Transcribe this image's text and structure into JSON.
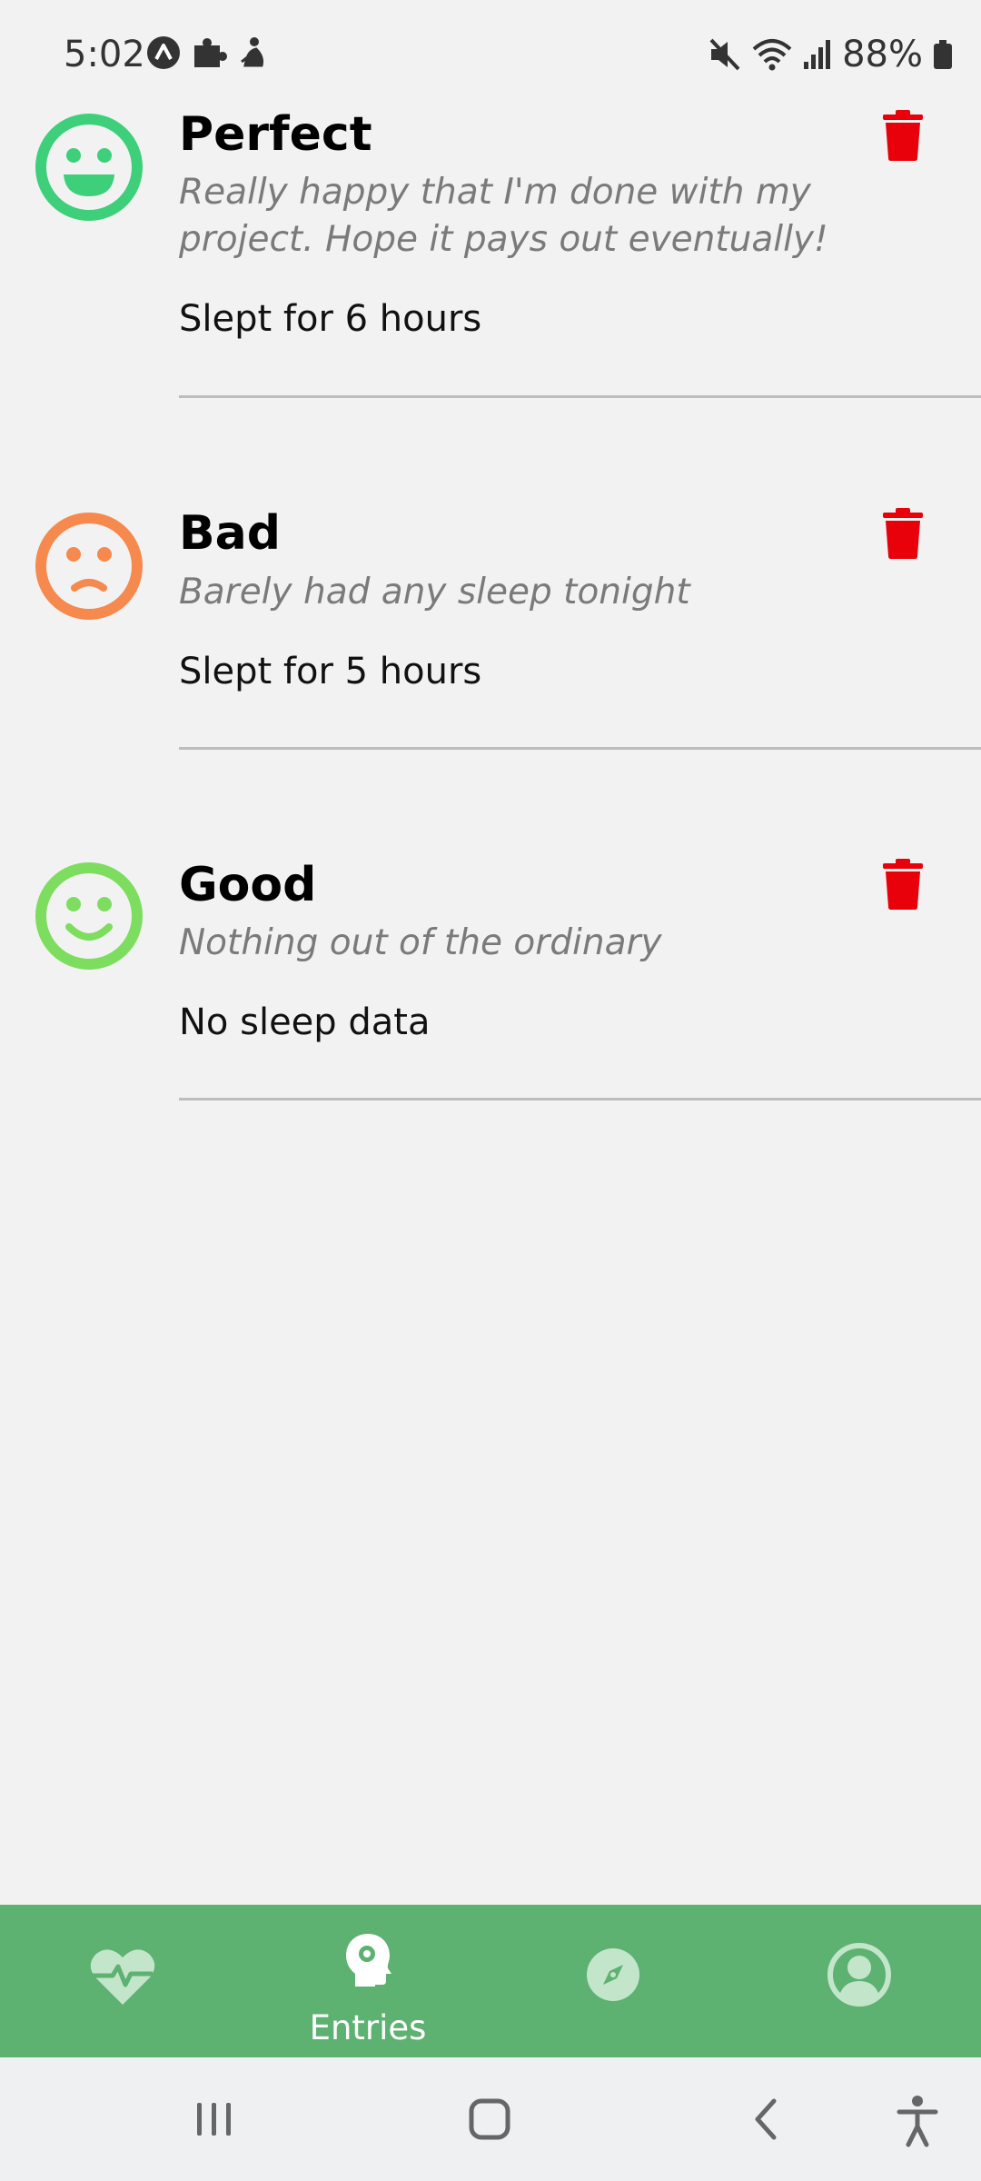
{
  "status_bar": {
    "time": "5:02",
    "battery": "88%",
    "left_icons": [
      "app-a-icon",
      "puzzle-icon",
      "figure-icon"
    ],
    "right_icons": [
      "mute-icon",
      "wifi-icon",
      "signal-icon",
      "battery-icon"
    ]
  },
  "entries": [
    {
      "mood": "Perfect",
      "note": "Really happy that I'm done with my project. Hope it pays out eventually!",
      "sleep": "Slept for 6 hours",
      "face": "grin",
      "color": "#3ecf7a"
    },
    {
      "mood": "Bad",
      "note": "Barely had any sleep tonight",
      "sleep": "Slept for 5 hours",
      "face": "sad",
      "color": "#f5894e"
    },
    {
      "mood": "Good",
      "note": "Nothing out of the ordinary",
      "sleep": "No sleep data",
      "face": "smile",
      "color": "#7ddd5e"
    }
  ],
  "colors": {
    "delete": "#e8000b",
    "nav_background": "#5db171",
    "background": "#f2f2f2"
  },
  "bottom_nav": {
    "items": [
      {
        "icon": "heart-pulse-icon",
        "label": "",
        "active": false
      },
      {
        "icon": "head-gear-icon",
        "label": "Entries",
        "active": true
      },
      {
        "icon": "compass-icon",
        "label": "",
        "active": false
      },
      {
        "icon": "profile-icon",
        "label": "",
        "active": false
      }
    ]
  },
  "system_nav": [
    "recents-icon",
    "home-icon",
    "back-icon",
    "accessibility-icon"
  ]
}
